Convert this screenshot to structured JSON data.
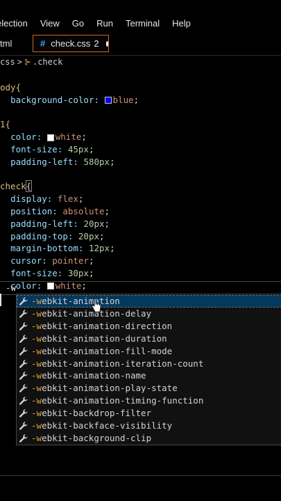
{
  "menubar": {
    "items": [
      "election",
      "View",
      "Go",
      "Run",
      "Terminal",
      "Help"
    ]
  },
  "tabs": {
    "html_label": "tml",
    "css_label": "check.css",
    "css_badge": "2"
  },
  "breadcrumb": {
    "file": "css",
    "symbol": ".check"
  },
  "code": {
    "l1_sel": "ody{",
    "l2_prop": "background-color:",
    "l2_val": "blue",
    "l4_sel": "1{",
    "l5_prop": "color:",
    "l5_val": "white",
    "l6_prop": "font-size:",
    "l6_val": "45px",
    "l7_prop": "padding-left:",
    "l7_val": "580px",
    "l9_sel": "check",
    "l9_brace": "{",
    "l10_prop": "display:",
    "l10_val": "flex",
    "l11_prop": "position:",
    "l11_val": "absolute",
    "l12_prop": "padding-left:",
    "l12_val": "20px",
    "l13_prop": "padding-top:",
    "l13_val": "20px",
    "l14_prop": "margin-bottom:",
    "l14_val": "12px",
    "l15_prop": "cursor:",
    "l15_val": "pointer",
    "l16_prop": "font-size:",
    "l16_val": "30px",
    "l17_prop": "color:",
    "l17_val": "white",
    "current": "-w"
  },
  "colors": {
    "blue_swatch": "#0000ff",
    "white_swatch": "#ffffff",
    "accent": "#cf6b1e"
  },
  "suggestions": {
    "prefix": "-w",
    "items": [
      {
        "match": "-w",
        "rest": "ebkit-animation"
      },
      {
        "match": "-w",
        "rest": "ebkit-animation-delay"
      },
      {
        "match": "-w",
        "rest": "ebkit-animation-direction"
      },
      {
        "match": "-w",
        "rest": "ebkit-animation-duration"
      },
      {
        "match": "-w",
        "rest": "ebkit-animation-fill-mode"
      },
      {
        "match": "-w",
        "rest": "ebkit-animation-iteration-count"
      },
      {
        "match": "-w",
        "rest": "ebkit-animation-name"
      },
      {
        "match": "-w",
        "rest": "ebkit-animation-play-state"
      },
      {
        "match": "-w",
        "rest": "ebkit-animation-timing-function"
      },
      {
        "match": "-w",
        "rest": "ebkit-backdrop-filter"
      },
      {
        "match": "-w",
        "rest": "ebkit-backface-visibility"
      },
      {
        "match": "-w",
        "rest": "ebkit-background-clip"
      }
    ],
    "icon": "wrench-icon"
  }
}
